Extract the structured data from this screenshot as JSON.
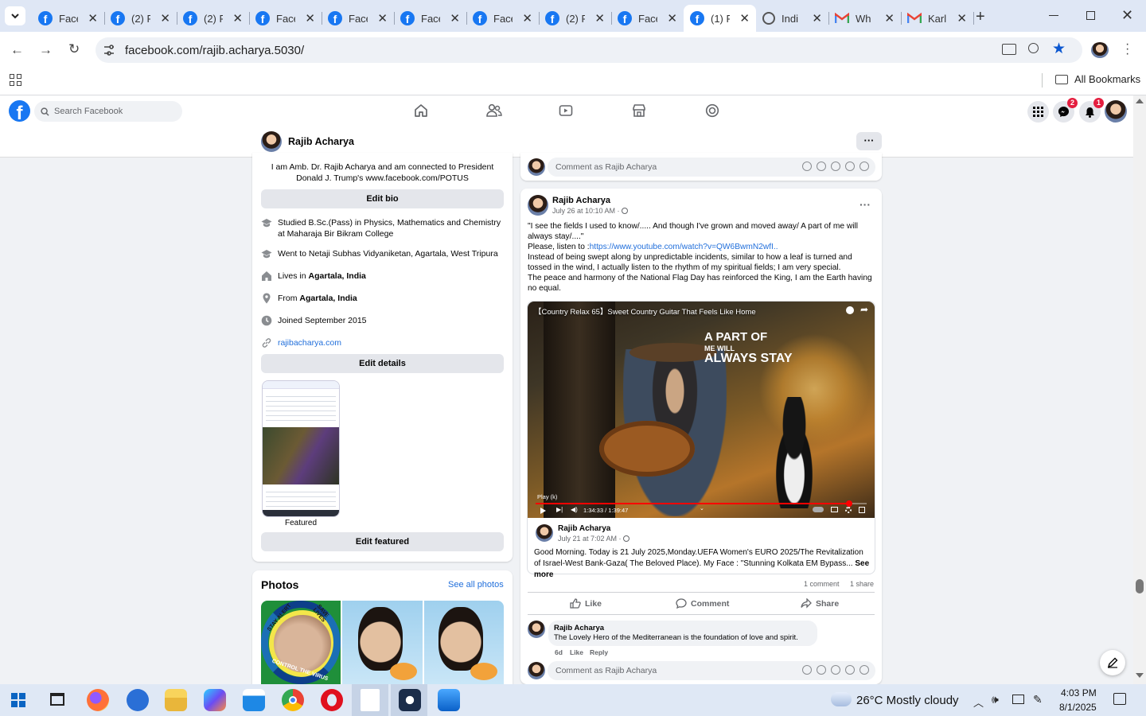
{
  "browser": {
    "tabs": [
      {
        "title": "Face",
        "icon": "facebook"
      },
      {
        "title": "(2) F",
        "icon": "facebook"
      },
      {
        "title": "(2) F",
        "icon": "facebook"
      },
      {
        "title": "Face",
        "icon": "facebook"
      },
      {
        "title": "Face",
        "icon": "facebook"
      },
      {
        "title": "Face",
        "icon": "facebook"
      },
      {
        "title": "Face",
        "icon": "facebook"
      },
      {
        "title": "(2) F",
        "icon": "facebook"
      },
      {
        "title": "Face",
        "icon": "facebook"
      },
      {
        "title": "(1) F",
        "icon": "facebook",
        "active": true
      },
      {
        "title": "Indi",
        "icon": "globe"
      },
      {
        "title": "Wh",
        "icon": "gmail"
      },
      {
        "title": "Karl",
        "icon": "gmail"
      }
    ],
    "url": "facebook.com/rajib.acharya.5030/",
    "bookmarks_label": "All Bookmarks"
  },
  "fb": {
    "search_placeholder": "Search Facebook",
    "messenger_badge": "2",
    "notif_badge": "1"
  },
  "profile_bar": {
    "name": "Rajib Acharya",
    "more": "···"
  },
  "intro": {
    "bio": "I am Amb. Dr. Rajib Acharya and am connected to President Donald J. Trump's www.facebook.com/POTUS",
    "edit_bio": "Edit bio",
    "studied": "Studied B.Sc.(Pass) in Physics, Mathematics and Chemistry at Maharaja Bir Bikram College",
    "went": "Went to Netaji Subhas Vidyaniketan, Agartala, West Tripura",
    "lives_prefix": "Lives in ",
    "lives": "Agartala, India",
    "from_prefix": "From ",
    "from": "Agartala, India",
    "joined": "Joined September 2015",
    "website": "rajibacharya.com",
    "edit_details": "Edit details",
    "featured": "Featured",
    "edit_featured": "Edit featured"
  },
  "photos": {
    "title": "Photos",
    "see_all": "See all photos",
    "sticker_top": "STAY ALERT",
    "sticker_right": "SAVE LIVES",
    "sticker_bottom": "CONTROL THE VIRUS"
  },
  "top_comment_box": {
    "placeholder": "Comment as Rajib Acharya"
  },
  "post": {
    "author": "Rajib Acharya",
    "time": "July 26 at 10:10 AM · ",
    "line1": "\"I see the fields I used to know/..... And though I've grown and moved away/ A part of me will always stay/....\"",
    "listen_prefix": "Please, listen to :",
    "listen_link": "https://www.youtube.com/watch?v=QW6BwmN2wfI..",
    "line3": "Instead of being swept along by unpredictable incidents, similar to how a leaf is turned and tossed in the wind, I actually listen to the rhythm of my spiritual fields; I am very special.",
    "line4": "The peace and harmony of the National Flag Day has reinforced the King, I am the Earth having no equal.",
    "video": {
      "title": "【Country Relax 65】Sweet Country Guitar That Feels Like Home",
      "overlay1": "A PART OF",
      "overlay2": "ME WILL",
      "overlay3": "ALWAYS STAY",
      "play_hint": "Play (k)",
      "time": "1:34:33 / 1:39:47",
      "progress": 0.948
    },
    "shared": {
      "author": "Rajib Acharya",
      "time": "July 21 at 7:02 AM · ",
      "text": "Good Morning. Today is 21 July 2025,Monday.UEFA Women's EURO 2025/The Revitalization of Israel-West Bank-Gaza( The Beloved Place). My Face : \"Stunning Kolkata EM Bypass...",
      "see_more": "See more"
    },
    "comments_count": "1 comment",
    "shares_count": "1 share",
    "like": "Like",
    "comment": "Comment",
    "share": "Share",
    "comment_item": {
      "author": "Rajib Acharya",
      "text": "The Lovely Hero of the Mediterranean is the foundation of love and spirit.",
      "age": "6d",
      "like": "Like",
      "reply": "Reply"
    },
    "comment_placeholder": "Comment as Rajib Acharya"
  },
  "taskbar": {
    "weather": "26°C  Mostly cloudy",
    "time": "4:03 PM",
    "date": "8/1/2025"
  }
}
